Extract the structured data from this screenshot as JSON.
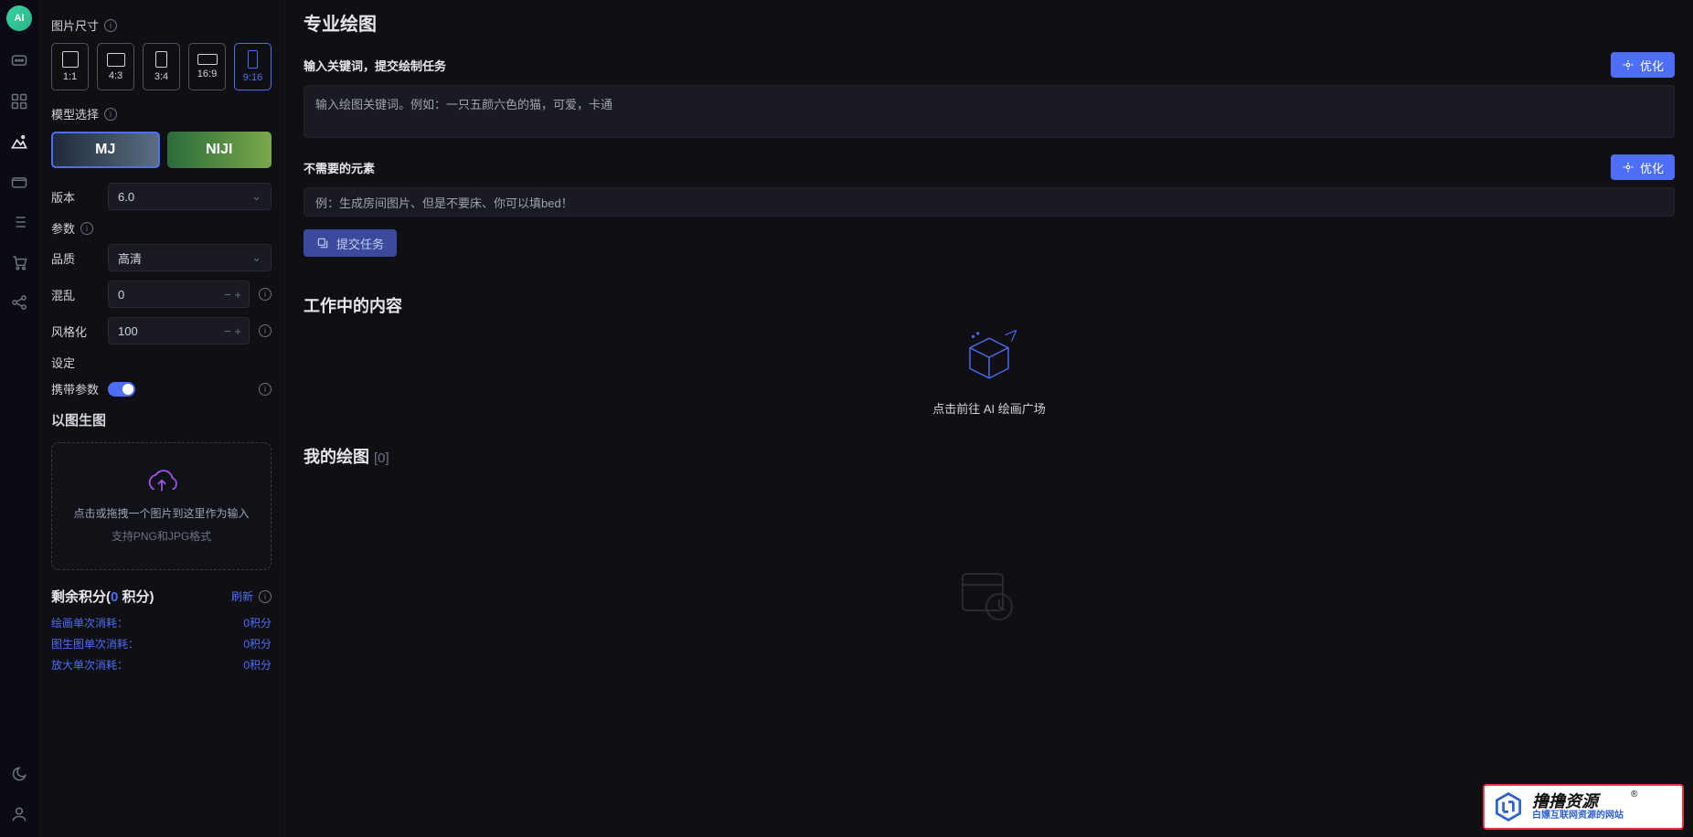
{
  "nav": {
    "logo": "AI"
  },
  "sidebar": {
    "image_size_label": "图片尺寸",
    "ratios": [
      "1:1",
      "4:3",
      "3:4",
      "16:9",
      "9:16"
    ],
    "model_select_label": "模型选择",
    "models": [
      "MJ",
      "NIJI"
    ],
    "version_label": "版本",
    "version_value": "6.0",
    "params_label": "参数",
    "quality_label": "品质",
    "quality_value": "高清",
    "chaos_label": "混乱",
    "chaos_value": "0",
    "stylize_label": "风格化",
    "stylize_value": "100",
    "settings_label": "设定",
    "carry_params_label": "携带参数",
    "img2img_label": "以图生图",
    "upload_main": "点击或拖拽一个图片到这里作为输入",
    "upload_sub": "支持PNG和JPG格式",
    "credits_title_prefix": "剩余积分(",
    "credits_num": "0",
    "credits_title_suffix": " 积分)",
    "refresh_label": "刷新",
    "cost_lines": [
      {
        "label": "绘画单次消耗：",
        "value": "0积分"
      },
      {
        "label": "图生图单次消耗：",
        "value": "0积分"
      },
      {
        "label": "放大单次消耗：",
        "value": "0积分"
      }
    ]
  },
  "main": {
    "title": "专业绘图",
    "prompt_label": "输入关键词，提交绘制任务",
    "optimize_label": "优化",
    "prompt_placeholder": "输入绘图关键词。例如：一只五颜六色的猫，可爱，卡通",
    "negative_label": "不需要的元素",
    "negative_placeholder": "例：生成房间图片、但是不要床、你可以填bed！",
    "submit_label": "提交任务",
    "working_title": "工作中的内容",
    "cube_text": "点击前往 AI 绘画广场",
    "my_draw_title": "我的绘图",
    "my_draw_count": "[0]"
  },
  "watermark": {
    "main": "撸撸资源",
    "sub": "白嫖互联网资源的网站",
    "r": "®"
  }
}
